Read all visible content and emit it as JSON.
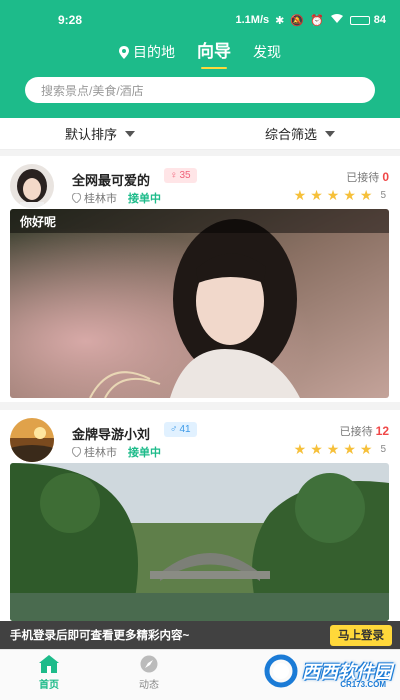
{
  "status_bar": {
    "time": "9:28",
    "network_speed": "1.1M/s",
    "battery": "84",
    "battery_level": 0.84
  },
  "top_tabs": [
    {
      "label": "目的地",
      "icon": "location-pin-icon"
    },
    {
      "label": "向导",
      "active": true
    },
    {
      "label": "发现"
    }
  ],
  "search": {
    "placeholder": "搜索景点/美食/酒店"
  },
  "filters": [
    {
      "label": "默认排序",
      "icon": "caret-down-icon"
    },
    {
      "label": "综合筛选",
      "icon": "caret-down-icon"
    }
  ],
  "guides": [
    {
      "name": "全网最可爱的",
      "gender_icon": "female-icon",
      "gender_symbol": "♀",
      "age": "35",
      "location": "桂林市",
      "status": "接单中",
      "served_label": "已接待",
      "served_count": "0",
      "rating": 5,
      "rating_text": "5",
      "caption": "你好呢"
    },
    {
      "name": "金牌导游小刘",
      "gender_icon": "male-icon",
      "gender_symbol": "♂",
      "age": "41",
      "location": "桂林市",
      "status": "接单中",
      "served_label": "已接待",
      "served_count": "12",
      "rating": 5,
      "rating_text": "5"
    }
  ],
  "banner": {
    "text": "手机登录后即可查看更多精彩内容~",
    "button": "马上登录"
  },
  "bottom_nav": [
    {
      "label": "首页",
      "icon": "home-icon",
      "active": true
    },
    {
      "label": "动态",
      "icon": "compass-icon"
    }
  ],
  "watermark": {
    "brand": "西西软件园",
    "domain": "CR173.COM"
  },
  "colors": {
    "brand": "#1dbb8a",
    "accent": "#ffd83a",
    "star": "#f6c03a",
    "count": "#f04747"
  }
}
